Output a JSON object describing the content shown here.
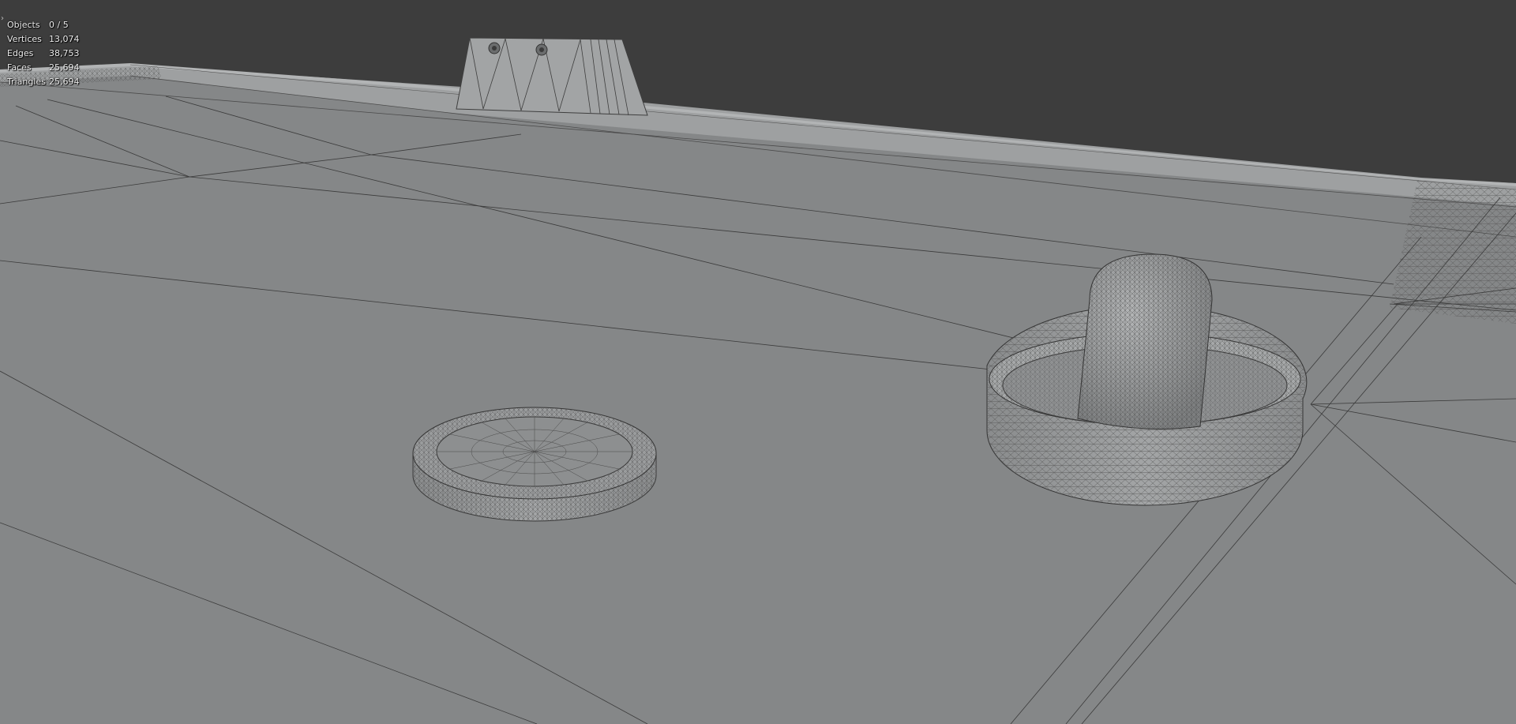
{
  "viewport": {
    "background": "#3d3d3d",
    "floor_color": "#858788",
    "shading": "solid with wireframe overlay"
  },
  "statistics": [
    {
      "label": "Objects",
      "value": "0 / 5"
    },
    {
      "label": "Vertices",
      "value": "13,074"
    },
    {
      "label": "Edges",
      "value": "38,753"
    },
    {
      "label": "Faces",
      "value": "25,694"
    },
    {
      "label": "Triangles",
      "value": "25,694"
    }
  ],
  "scene_objects": [
    "table-surface",
    "table-rail",
    "goal-block",
    "puck",
    "mallet"
  ],
  "icons": {
    "corner_toggle": "chevron-right-icon"
  }
}
